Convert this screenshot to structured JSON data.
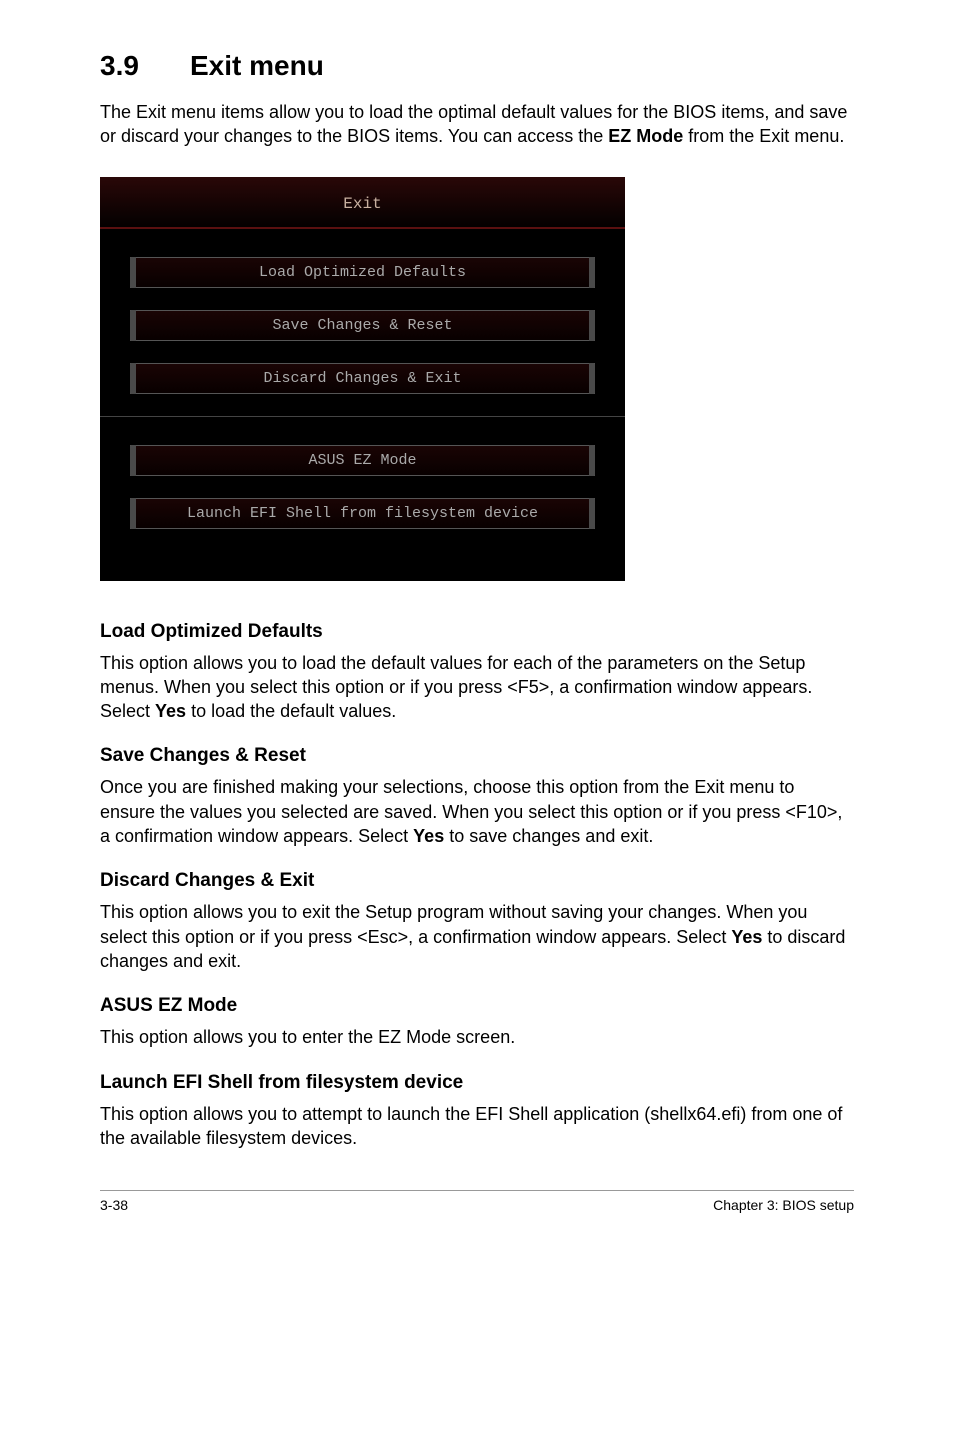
{
  "section": {
    "number": "3.9",
    "title": "Exit menu"
  },
  "intro": {
    "pre": "The Exit menu items allow you to load the optimal default values for the BIOS items, and save or discard your changes to the BIOS items. You can access the ",
    "bold": "EZ Mode",
    "post": " from the Exit menu."
  },
  "bios": {
    "title": "Exit",
    "buttons": {
      "b1": "Load Optimized Defaults",
      "b2": "Save Changes & Reset",
      "b3": "Discard Changes & Exit",
      "b4": "ASUS EZ Mode",
      "b5": "Launch EFI Shell from filesystem device"
    }
  },
  "sections": {
    "s1": {
      "head": "Load Optimized Defaults",
      "pre": "This option allows you to load the default values for each of the parameters on the Setup menus. When you select this option or if you press <F5>, a confirmation window appears. Select ",
      "bold": "Yes",
      "post": " to load the default values."
    },
    "s2": {
      "head": "Save Changes & Reset",
      "pre": "Once you are finished making your selections, choose this option from the Exit menu to ensure the values you selected are saved. When you select this option or if you press <F10>, a confirmation window appears. Select ",
      "bold": "Yes",
      "post": " to save changes and exit."
    },
    "s3": {
      "head": "Discard Changes & Exit",
      "pre": "This option allows you to exit the Setup program without saving your changes. When you select this option or if you press <Esc>, a confirmation window appears. Select ",
      "bold": "Yes",
      "post": " to discard changes and exit."
    },
    "s4": {
      "head": "ASUS EZ Mode",
      "text": "This option allows you to enter the EZ Mode screen."
    },
    "s5": {
      "head": "Launch EFI Shell from filesystem device",
      "text": "This option allows you to attempt to launch the EFI Shell application (shellx64.efi) from one of the available filesystem devices."
    }
  },
  "footer": {
    "left": "3-38",
    "right": "Chapter 3: BIOS setup"
  }
}
